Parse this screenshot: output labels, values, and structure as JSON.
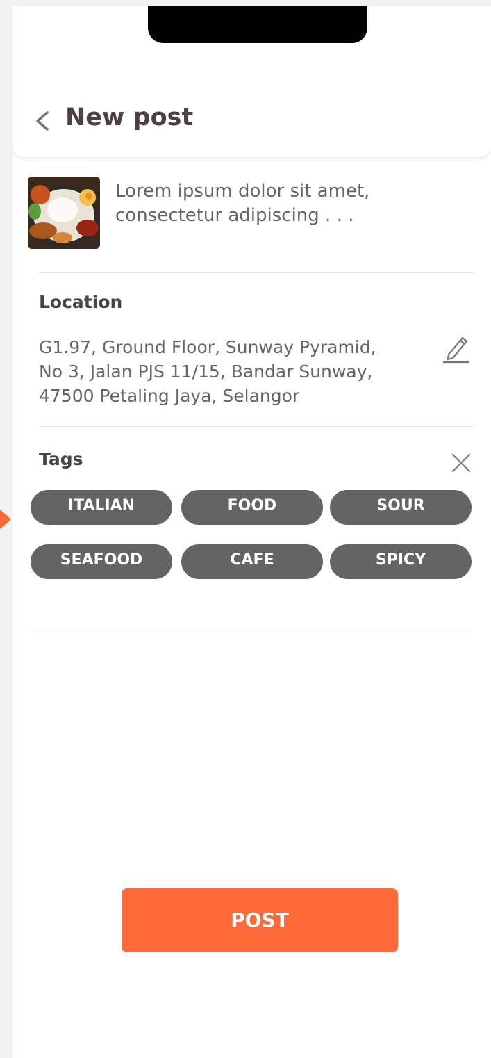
{
  "header": {
    "title": "New post"
  },
  "post": {
    "caption": "Lorem ipsum dolor sit amet, consectetur adipiscing . . ."
  },
  "location": {
    "label": "Location",
    "address_line1": "G1.97, Ground Floor, Sunway Pyramid,",
    "address_line2": "No 3, Jalan PJS 11/15, Bandar Sunway,",
    "address_line3": "47500 Petaling Jaya, Selangor"
  },
  "tags": {
    "label": "Tags",
    "items": [
      "ITALIAN",
      "FOOD",
      "SOUR",
      "SEAFOOD",
      "CAFE",
      "SPICY"
    ]
  },
  "actions": {
    "post_label": "POST"
  },
  "colors": {
    "accent": "#ff6a38",
    "tag_bg": "#646464",
    "text_dark": "#4e4040",
    "decor_teal": "#2bb9c4"
  },
  "icons": [
    "chevron-left-icon",
    "pencil-icon",
    "close-icon"
  ]
}
